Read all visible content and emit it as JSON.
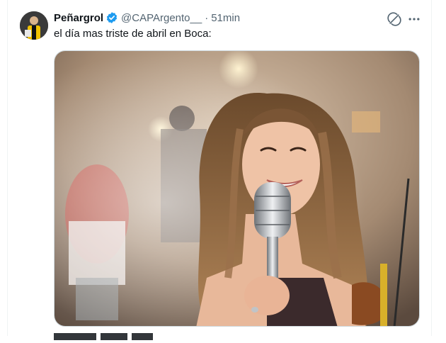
{
  "tweet": {
    "display_name": "Peñargrol",
    "handle": "@CAPArgento__",
    "separator": "·",
    "time": "51min",
    "text": "el día mas triste de abril en Boca:",
    "verified_color": "#1d9bf0"
  },
  "icons": {
    "avatar": "avatar",
    "verified": "verified-badge-icon",
    "grok": "grok-icon",
    "more": "more-dots-icon"
  },
  "media": {
    "type": "image",
    "description_label": "woman-singing-into-vintage-microphone"
  },
  "colors": {
    "text_primary": "#0f1419",
    "text_secondary": "#536471",
    "border": "#cfd9de"
  }
}
